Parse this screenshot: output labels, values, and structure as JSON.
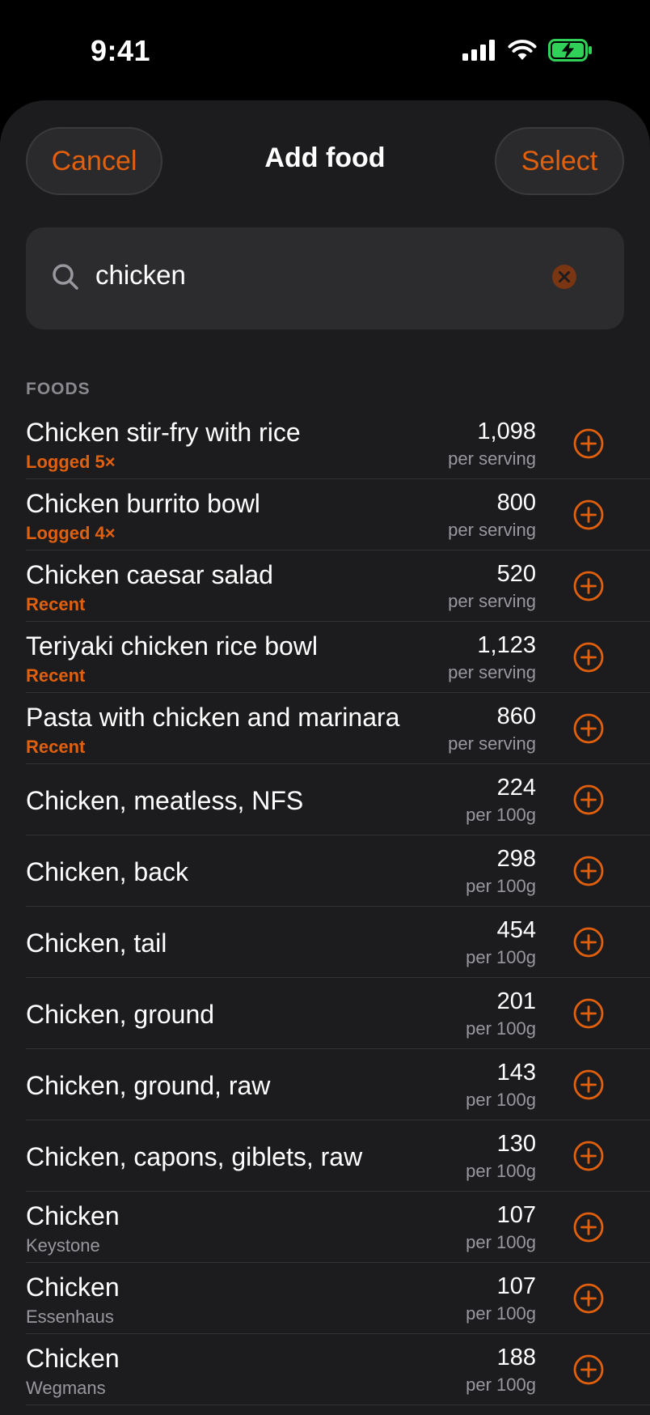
{
  "status_bar": {
    "time": "9:41"
  },
  "header": {
    "cancel_label": "Cancel",
    "title": "Add food",
    "select_label": "Select"
  },
  "search": {
    "value": "chicken"
  },
  "section": {
    "title": "FOODS"
  },
  "colors": {
    "accent": "#e2600d",
    "background": "#1c1c1e",
    "battery": "#30d158"
  },
  "foods": [
    {
      "name": "Chicken stir-fry with rice",
      "subtitle": "Logged 5×",
      "subtitle_kind": "tag",
      "calories": "1,098",
      "unit": "per serving"
    },
    {
      "name": "Chicken burrito bowl",
      "subtitle": "Logged 4×",
      "subtitle_kind": "tag",
      "calories": "800",
      "unit": "per serving"
    },
    {
      "name": "Chicken caesar salad",
      "subtitle": "Recent",
      "subtitle_kind": "tag",
      "calories": "520",
      "unit": "per serving"
    },
    {
      "name": "Teriyaki chicken rice bowl",
      "subtitle": "Recent",
      "subtitle_kind": "tag",
      "calories": "1,123",
      "unit": "per serving"
    },
    {
      "name": "Pasta with chicken and marinara",
      "subtitle": "Recent",
      "subtitle_kind": "tag",
      "calories": "860",
      "unit": "per serving"
    },
    {
      "name": "Chicken, meatless, NFS",
      "subtitle": "",
      "subtitle_kind": "none",
      "calories": "224",
      "unit": "per 100g"
    },
    {
      "name": "Chicken, back",
      "subtitle": "",
      "subtitle_kind": "none",
      "calories": "298",
      "unit": "per 100g"
    },
    {
      "name": "Chicken, tail",
      "subtitle": "",
      "subtitle_kind": "none",
      "calories": "454",
      "unit": "per 100g"
    },
    {
      "name": "Chicken, ground",
      "subtitle": "",
      "subtitle_kind": "none",
      "calories": "201",
      "unit": "per 100g"
    },
    {
      "name": "Chicken, ground, raw",
      "subtitle": "",
      "subtitle_kind": "none",
      "calories": "143",
      "unit": "per 100g"
    },
    {
      "name": "Chicken, capons, giblets, raw",
      "subtitle": "",
      "subtitle_kind": "none",
      "calories": "130",
      "unit": "per 100g"
    },
    {
      "name": "Chicken",
      "subtitle": "Keystone",
      "subtitle_kind": "brand",
      "calories": "107",
      "unit": "per 100g"
    },
    {
      "name": "Chicken",
      "subtitle": "Essenhaus",
      "subtitle_kind": "brand",
      "calories": "107",
      "unit": "per 100g"
    },
    {
      "name": "Chicken",
      "subtitle": "Wegmans",
      "subtitle_kind": "brand",
      "calories": "188",
      "unit": "per 100g"
    }
  ]
}
